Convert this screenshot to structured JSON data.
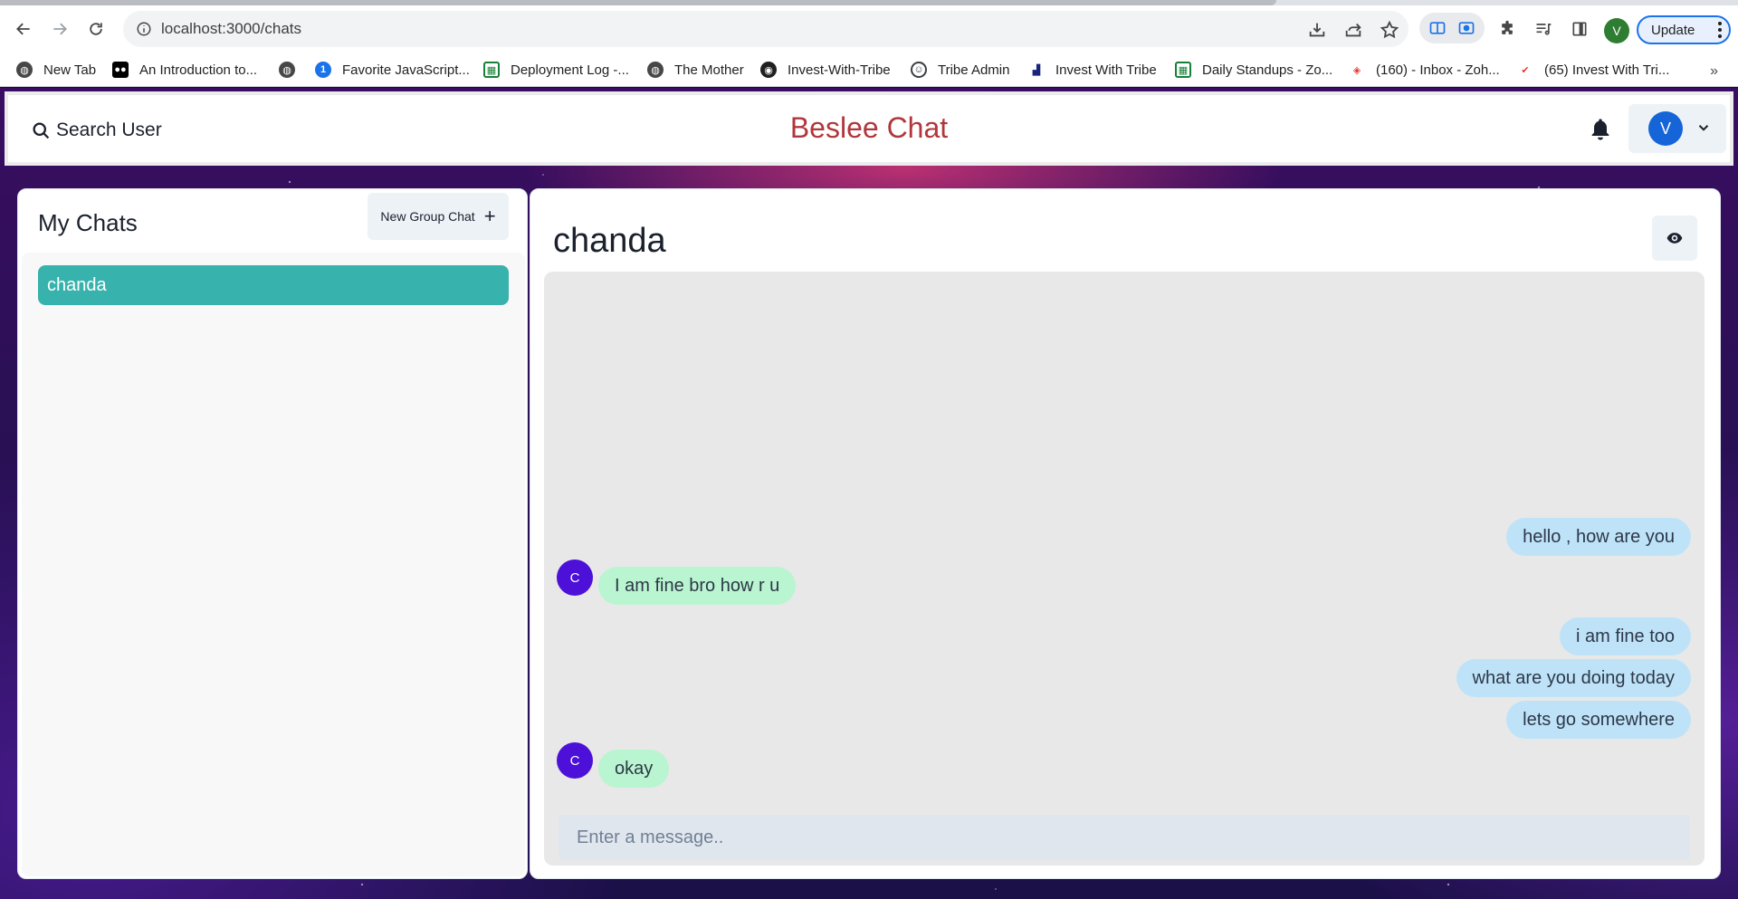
{
  "browser": {
    "url": "localhost:3000/chats",
    "update_label": "Update",
    "profile_initial": "V",
    "bookmarks": [
      {
        "label": "New Tab",
        "icon": "globe-icon",
        "color": "#474747"
      },
      {
        "label": "An Introduction to...",
        "icon": "medium-icon",
        "color": "#000000"
      },
      {
        "label": "",
        "icon": "globe-icon",
        "color": "#474747"
      },
      {
        "label": "Favorite JavaScript...",
        "icon": "one-password-icon",
        "color": "#1a73e8"
      },
      {
        "label": "Deployment Log -...",
        "icon": "sheets-icon",
        "color": "#188038"
      },
      {
        "label": "The Mother",
        "icon": "globe-icon",
        "color": "#474747"
      },
      {
        "label": "Invest-With-Tribe",
        "icon": "github-icon",
        "color": "#1f1f1f"
      },
      {
        "label": "Tribe Admin",
        "icon": "tribe-icon",
        "color": "#3c4043"
      },
      {
        "label": "Invest With Tribe",
        "icon": "chart-icon",
        "color": "#1a237e"
      },
      {
        "label": "Daily Standups - Zo...",
        "icon": "sheets-icon",
        "color": "#188038"
      },
      {
        "label": "(160) - Inbox - Zoh...",
        "icon": "zoho-mail-icon",
        "color": "#e53935"
      },
      {
        "label": "(65) Invest With Tri...",
        "icon": "gmail-check-icon",
        "color": "#e53935"
      }
    ]
  },
  "header": {
    "search_label": "Search User",
    "brand": "Beslee Chat",
    "user_initial": "V"
  },
  "sidebar": {
    "title": "My Chats",
    "new_group_label": "New Group Chat",
    "new_group_icon": "+",
    "chats": [
      {
        "name": "chanda",
        "selected": true
      }
    ]
  },
  "conversation": {
    "peer_name": "chanda",
    "peer_initial": "C",
    "messages": [
      {
        "from": "me",
        "text": "hello , how are you"
      },
      {
        "from": "them",
        "text": "I am fine bro how r u"
      },
      {
        "from": "me",
        "text": "i am fine too"
      },
      {
        "from": "me",
        "text": "what are you doing today"
      },
      {
        "from": "me",
        "text": "lets go somewhere"
      },
      {
        "from": "them",
        "text": "okay"
      }
    ],
    "composer_placeholder": "Enter a message.."
  },
  "colors": {
    "brand": "#b0373b",
    "selected_chat": "#38b2ac",
    "my_bubble": "#bee3f8",
    "their_bubble": "#b9f5d0",
    "avatar": "#4c10d8",
    "user_avatar": "#1565d8"
  }
}
